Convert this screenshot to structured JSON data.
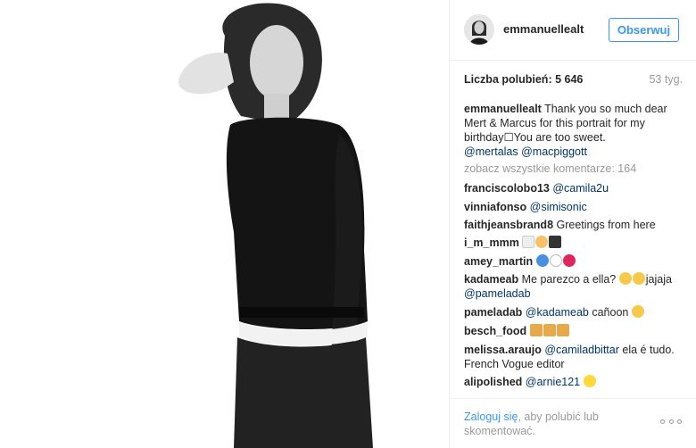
{
  "post": {
    "username": "emmanuellealt",
    "follow_label": "Obserwuj",
    "likes_label": "Liczba polubień: 5 646",
    "time_ago": "53 tyg.",
    "caption_user": "emmanuellealt",
    "caption_text": "Thank you so much dear Mert & Marcus for this portrait for my birthday☐You are too sweet.",
    "caption_mention_1": "@mertalas",
    "caption_mention_2": "@macpiggott",
    "view_all": "zobacz wszystkie komentarze: 164"
  },
  "comments": [
    {
      "user": "franciscolobo13",
      "mention": "@camila2u"
    },
    {
      "user": "vinniafonso",
      "mention": "@simisonic"
    },
    {
      "user": "faithjeansbrand8",
      "text": "Greetings from here"
    },
    {
      "user": "i_m_mmm"
    },
    {
      "user": "amey_martin"
    },
    {
      "user": "kadameab",
      "text": "Me parezco a ella?",
      "text2": "jajaja",
      "mention": "@pameladab"
    },
    {
      "user": "pameladab",
      "mention": "@kadameab",
      "text": "cañoon"
    },
    {
      "user": "besch_food"
    },
    {
      "user": "melissa.araujo",
      "mention": "@camiladbittar",
      "text": "ela é tudo. French Vogue editor"
    },
    {
      "user": "alipolished",
      "mention": "@arnie121"
    }
  ],
  "footer": {
    "login_link": "Zaloguj się",
    "login_rest": ", aby polubić lub skomentować."
  },
  "colors": {
    "accent": "#3897f0",
    "mention": "#003569",
    "muted": "#999999",
    "text": "#262626"
  },
  "icons": {
    "more": "more-options-icon",
    "emoji_smile": "grinning-emoji-icon",
    "emoji_pray": "praying-hands-emoji-icon",
    "emoji_heart": "heart-emoji-icon"
  }
}
